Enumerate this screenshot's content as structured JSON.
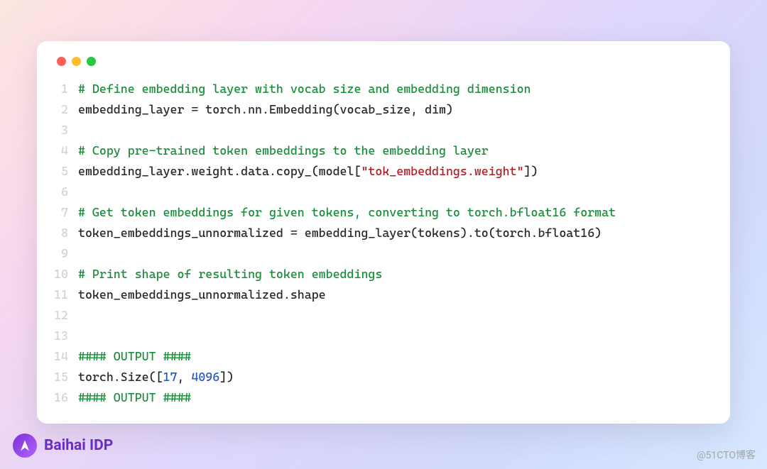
{
  "brand": {
    "name": "Baihai IDP"
  },
  "watermark": "@51CTO博客",
  "code": {
    "lines": [
      {
        "n": "1",
        "tokens": [
          {
            "t": "# Define embedding layer with vocab size and embedding dimension",
            "cls": "c-comment"
          }
        ]
      },
      {
        "n": "2",
        "tokens": [
          {
            "t": "embedding_layer = torch.nn.Embedding(vocab_size, dim)",
            "cls": ""
          }
        ]
      },
      {
        "n": "3",
        "tokens": [
          {
            "t": "",
            "cls": ""
          }
        ]
      },
      {
        "n": "4",
        "tokens": [
          {
            "t": "# Copy pre-trained token embeddings to the embedding layer",
            "cls": "c-comment"
          }
        ]
      },
      {
        "n": "5",
        "tokens": [
          {
            "t": "embedding_layer.weight.data.copy_(model[",
            "cls": ""
          },
          {
            "t": "\"tok_embeddings.weight\"",
            "cls": "c-string"
          },
          {
            "t": "])",
            "cls": ""
          }
        ]
      },
      {
        "n": "6",
        "tokens": [
          {
            "t": "",
            "cls": ""
          }
        ]
      },
      {
        "n": "7",
        "tokens": [
          {
            "t": "# Get token embeddings for given tokens, converting to torch.bfloat16 format",
            "cls": "c-comment"
          }
        ]
      },
      {
        "n": "8",
        "tokens": [
          {
            "t": "token_embeddings_unnormalized = embedding_layer(tokens).to(torch.bfloat16)",
            "cls": ""
          }
        ]
      },
      {
        "n": "9",
        "tokens": [
          {
            "t": "",
            "cls": ""
          }
        ]
      },
      {
        "n": "10",
        "tokens": [
          {
            "t": "# Print shape of resulting token embeddings",
            "cls": "c-comment"
          }
        ]
      },
      {
        "n": "11",
        "tokens": [
          {
            "t": "token_embeddings_unnormalized.shape",
            "cls": ""
          }
        ]
      },
      {
        "n": "12",
        "tokens": [
          {
            "t": "",
            "cls": ""
          }
        ]
      },
      {
        "n": "13",
        "tokens": [
          {
            "t": "",
            "cls": ""
          }
        ]
      },
      {
        "n": "14",
        "tokens": [
          {
            "t": "#### OUTPUT ####",
            "cls": "c-comment"
          }
        ]
      },
      {
        "n": "15",
        "tokens": [
          {
            "t": "torch.Size([",
            "cls": ""
          },
          {
            "t": "17",
            "cls": "c-number"
          },
          {
            "t": ", ",
            "cls": ""
          },
          {
            "t": "4096",
            "cls": "c-number"
          },
          {
            "t": "])",
            "cls": ""
          }
        ]
      },
      {
        "n": "16",
        "tokens": [
          {
            "t": "#### OUTPUT ####",
            "cls": "c-comment"
          }
        ]
      }
    ]
  }
}
